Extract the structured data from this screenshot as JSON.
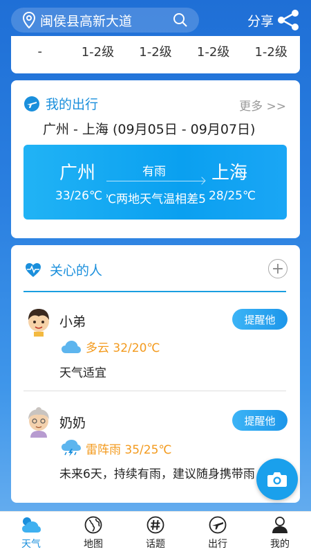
{
  "header": {
    "location": "闽侯县高新大道",
    "share_label": "分享"
  },
  "wind_row": [
    "-",
    "1-2级",
    "1-2级",
    "1-2级",
    "1-2级"
  ],
  "trip": {
    "title": "我的出行",
    "more_label": "更多 >>",
    "route": "广州 - 上海 (09月05日 - 09月07日)",
    "from_city": "广州",
    "to_city": "上海",
    "from_temp": "33/26℃",
    "to_temp": "28/25℃",
    "mid_weather": "有雨",
    "mid_diff": "两地天气温相差5℃"
  },
  "care": {
    "title": "关心的人",
    "add_label": "+",
    "people": [
      {
        "name": "小弟",
        "remind": "提醒他",
        "weather": "多云 32/20℃",
        "advice": "天气适宜"
      },
      {
        "name": "奶奶",
        "remind": "提醒他",
        "weather": "雷阵雨 35/25℃",
        "advice": "未来6天，持续有雨，建议随身携带雨"
      }
    ]
  },
  "tabs": [
    {
      "label": "天气",
      "icon": "weather-icon",
      "active": true
    },
    {
      "label": "地图",
      "icon": "globe-icon",
      "active": false
    },
    {
      "label": "话题",
      "icon": "hashtag-icon",
      "active": false
    },
    {
      "label": "出行",
      "icon": "plane-icon",
      "active": false
    },
    {
      "label": "我的",
      "icon": "person-icon",
      "active": false
    }
  ],
  "colors": {
    "accent": "#1a8fdc",
    "weather_text": "#f39a1d",
    "panel": "#0aa0f0"
  }
}
